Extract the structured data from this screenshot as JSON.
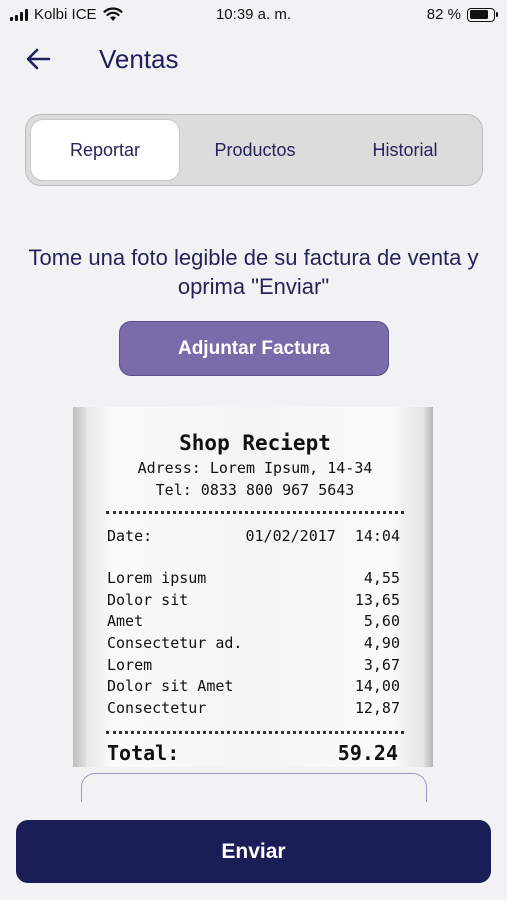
{
  "status_bar": {
    "carrier": "Kolbi ICE",
    "time": "10:39 a. m.",
    "battery_percent": "82 %",
    "battery_level": 0.82
  },
  "header": {
    "back_icon": "arrow-left-icon",
    "title": "Ventas"
  },
  "tabs": [
    {
      "label": "Reportar",
      "active": true
    },
    {
      "label": "Productos",
      "active": false
    },
    {
      "label": "Historial",
      "active": false
    }
  ],
  "instructions": "Tome una foto legible de su factura de venta y oprima \"Enviar\"",
  "attach_button": "Adjuntar Factura",
  "receipt": {
    "shop": "Shop Reciept",
    "address": "Adress: Lorem Ipsum, 14-34",
    "tel": "Tel: 0833 800 967 5643",
    "date_label": "Date:",
    "date_value": "01/02/2017 14:04",
    "items": [
      {
        "name": "Lorem ipsum",
        "price": "4,55"
      },
      {
        "name": "Dolor sit",
        "price": "13,65"
      },
      {
        "name": "Amet",
        "price": "5,60"
      },
      {
        "name": "Consectetur ad.",
        "price": "4,90"
      },
      {
        "name": "Lorem",
        "price": "3,67"
      },
      {
        "name": "Dolor sit Amet",
        "price": "14,00"
      },
      {
        "name": "Consectetur",
        "price": "12,87"
      }
    ],
    "total_label": "Total:",
    "total_value": "59.24"
  },
  "send_button": "Enviar",
  "colors": {
    "primary": "#1b1d57",
    "accent": "#7a6cab",
    "background": "#f2f2f5"
  }
}
